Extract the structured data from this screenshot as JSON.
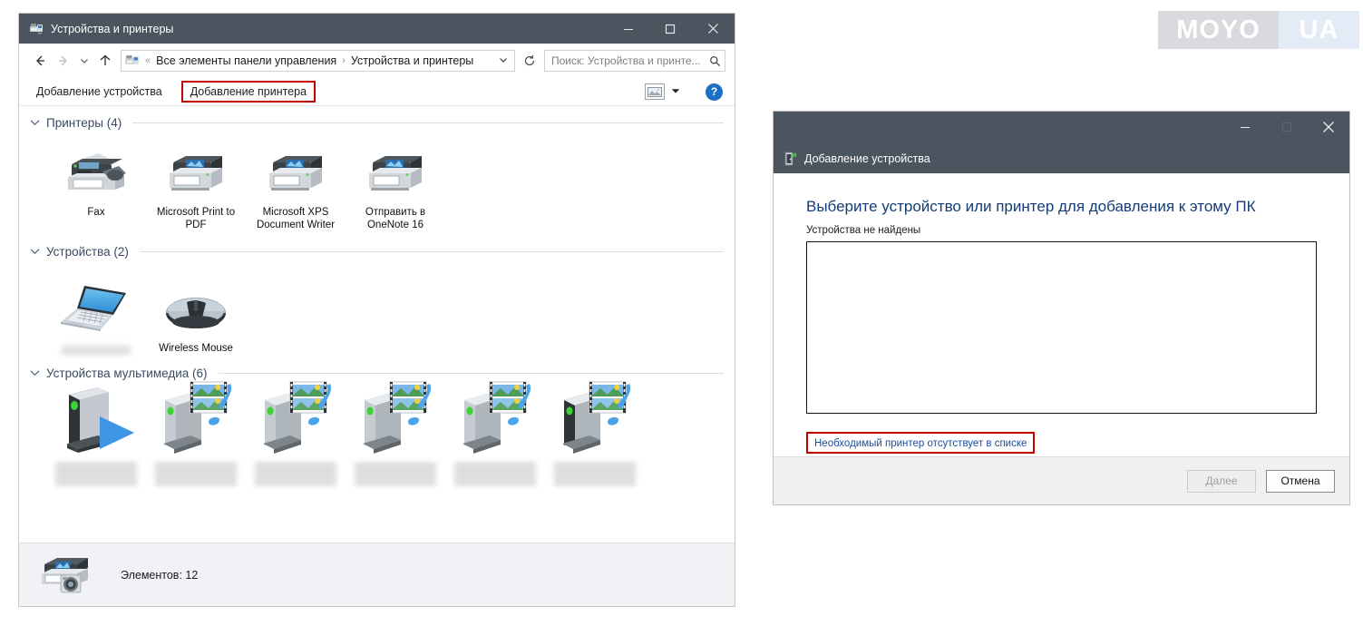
{
  "watermark": {
    "part1": "MOYO",
    "part2": "UA",
    "color_a": "#d9dade",
    "color_b": "#e3ecf6"
  },
  "explorer": {
    "title": "Устройства и принтеры",
    "titlebar_icon": "devices-and-printers-icon",
    "window_buttons": {
      "minimize": "minimize-icon",
      "maximize": "maximize-icon",
      "close": "close-icon"
    },
    "nav": {
      "back": "back-arrow-icon",
      "forward": "forward-arrow-icon",
      "recent": "chevron-down-icon",
      "up": "up-arrow-icon"
    },
    "address": {
      "icon": "devices-and-printers-icon",
      "overflow": "«",
      "crumb1": "Все элементы панели управления",
      "separator": "›",
      "crumb2": "Устройства и принтеры",
      "dropdown": "chevron-down-icon",
      "refresh": "refresh-icon"
    },
    "search": {
      "placeholder": "Поиск: Устройства и принте...",
      "icon": "search-icon"
    },
    "commandbar": {
      "add_device": "Добавление устройства",
      "add_printer": "Добавление принтера",
      "highlight_color": "#c00000",
      "view_icon": "view-layout-icon",
      "view_caret": "chevron-down-icon",
      "help": "?"
    },
    "groups": [
      {
        "label": "Принтеры (4)",
        "caret": "chevron-down-icon",
        "items": [
          {
            "label": "Fax",
            "icon": "fax-printer-icon",
            "blurred": false
          },
          {
            "label": "Microsoft Print to PDF",
            "icon": "printer-icon",
            "blurred": false
          },
          {
            "label": "Microsoft XPS Document Writer",
            "icon": "printer-icon",
            "blurred": false
          },
          {
            "label": "Отправить в OneNote 16",
            "icon": "printer-icon",
            "blurred": false
          }
        ]
      },
      {
        "label": "Устройства (2)",
        "caret": "chevron-down-icon",
        "items": [
          {
            "label": "",
            "icon": "laptop-icon",
            "blurred": true
          },
          {
            "label": "Wireless Mouse",
            "icon": "mouse-icon",
            "blurred": false
          }
        ]
      },
      {
        "label": "Устройства мультимедиа (6)",
        "caret": "chevron-down-icon",
        "items": [
          {
            "label": "",
            "icon": "media-player-icon",
            "blurred": true
          },
          {
            "label": "",
            "icon": "media-server-icon",
            "blurred": true
          },
          {
            "label": "",
            "icon": "media-server-icon",
            "blurred": true
          },
          {
            "label": "",
            "icon": "media-server-icon",
            "blurred": true
          },
          {
            "label": "",
            "icon": "media-server-icon",
            "blurred": true
          },
          {
            "label": "",
            "icon": "media-server-icon",
            "blurred": true
          }
        ]
      }
    ],
    "statusbar": {
      "icon": "printer-scanner-icon",
      "text": "Элементов: 12"
    }
  },
  "dialog": {
    "title": "Добавление устройства",
    "title_icon": "add-device-icon",
    "window_buttons": {
      "minimize": "minimize-icon",
      "maximize": "maximize-icon",
      "close": "close-icon"
    },
    "heading": "Выберите устройство или принтер для добавления к этому ПК",
    "subtext": "Устройства не найдены",
    "list_items": [],
    "link": "Необходимый принтер отсутствует в списке",
    "link_highlight_color": "#c00000",
    "buttons": {
      "next": "Далее",
      "next_disabled": true,
      "cancel": "Отмена"
    }
  }
}
